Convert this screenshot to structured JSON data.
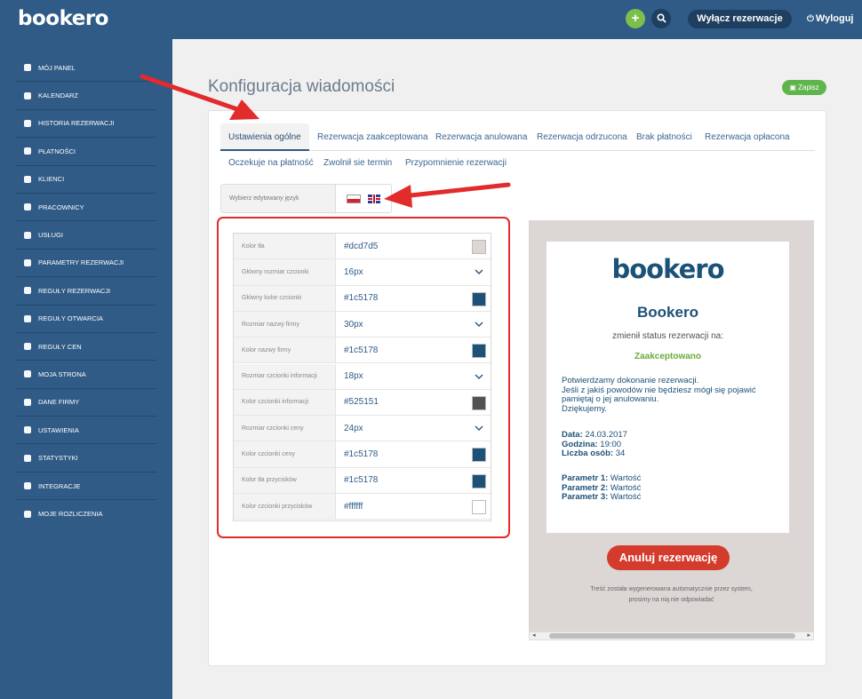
{
  "header": {
    "logo": "bookero",
    "add_label": "+",
    "toggle_label": "Wyłącz rezerwacje",
    "logout_label": "Wyloguj",
    "power_glyph": "⏻"
  },
  "sidebar": {
    "items": [
      {
        "label": "MÓJ PANEL",
        "icon": "dashboard-icon"
      },
      {
        "label": "KALENDARZ",
        "icon": "calendar-icon"
      },
      {
        "label": "HISTORIA REZERWACJI",
        "icon": "history-icon"
      },
      {
        "label": "PŁATNOŚCI",
        "icon": "credit-card-icon"
      },
      {
        "label": "KLIENCI",
        "icon": "users-icon"
      },
      {
        "label": "PRACOWNICY",
        "icon": "user-add-icon"
      },
      {
        "label": "USŁUGI",
        "icon": "cubes-icon"
      },
      {
        "label": "PARAMETRY REZERWACJI",
        "icon": "wrench-icon"
      },
      {
        "label": "REGUŁY REZERWACJI",
        "icon": "info-icon"
      },
      {
        "label": "REGUŁY OTWARCIA",
        "icon": "calendar-grid-icon"
      },
      {
        "label": "REGUŁY CEN",
        "icon": "dollar-icon"
      },
      {
        "label": "MOJA STRONA",
        "icon": "page-icon"
      },
      {
        "label": "DANE FIRMY",
        "icon": "building-icon"
      },
      {
        "label": "USTAWIENIA",
        "icon": "gear-icon"
      },
      {
        "label": "STATYSTYKI",
        "icon": "chart-icon"
      },
      {
        "label": "INTEGRACJE",
        "icon": "external-link-icon"
      },
      {
        "label": "MOJE ROZLICZENIA",
        "icon": "bank-icon"
      }
    ]
  },
  "page": {
    "title": "Konfiguracja wiadomości",
    "save_label": "Zapisz"
  },
  "tabs_row1": [
    "Ustawienia ogólne",
    "Rezerwacja zaakceptowana",
    "Rezerwacja anulowana",
    "Rezerwacja odrzucona",
    "Brak płatności",
    "Rezerwacja opłacona"
  ],
  "tabs_row2": [
    "Oczekuje na płatność",
    "Zwolnił sie termin",
    "Przypomnienie rezerwacji"
  ],
  "language": {
    "label": "Wybierz edytowany język"
  },
  "settings": [
    {
      "label": "Kolor tła",
      "value": "#dcd7d5",
      "kind": "color",
      "color": "#dcd7d5"
    },
    {
      "label": "Główny rozmiar czcionki",
      "value": "16px",
      "kind": "select"
    },
    {
      "label": "Główny kolor czcionki",
      "value": "#1c5178",
      "kind": "color",
      "color": "#1c5178"
    },
    {
      "label": "Rozmiar nazwy firmy",
      "value": "30px",
      "kind": "select"
    },
    {
      "label": "Kolor nazwy firmy",
      "value": "#1c5178",
      "kind": "color",
      "color": "#1c5178"
    },
    {
      "label": "Rozmiar czcionki informacji",
      "value": "18px",
      "kind": "select"
    },
    {
      "label": "Kolor czcionki informacji",
      "value": "#525151",
      "kind": "color",
      "color": "#525151"
    },
    {
      "label": "Rozmiar czcionki ceny",
      "value": "24px",
      "kind": "select"
    },
    {
      "label": "Kolor czcionki ceny",
      "value": "#1c5178",
      "kind": "color",
      "color": "#1c5178"
    },
    {
      "label": "Kolor tła przycisków",
      "value": "#1c5178",
      "kind": "color",
      "color": "#1c5178"
    },
    {
      "label": "Kolor czcionki przycisków",
      "value": "#ffffff",
      "kind": "color",
      "color": "#ffffff"
    }
  ],
  "preview": {
    "logo": "bookero",
    "company": "Bookero",
    "status_text": "zmienił status rezerwacji na:",
    "status": "Zaakceptowano",
    "info": [
      "Potwierdzamy dokonanie rezerwacji.",
      "Jeśli z jakiś powodów nie będziesz mógł się pojawić pamiętaj o jej anulowaniu.",
      "Dziękujemy."
    ],
    "details": [
      {
        "label": "Data:",
        "value": "24.03.2017"
      },
      {
        "label": "Godzina:",
        "value": "19:00"
      },
      {
        "label": "Liczba osób:",
        "value": "34"
      }
    ],
    "params": [
      {
        "label": "Parametr 1:",
        "value": "Wartość"
      },
      {
        "label": "Parametr 2:",
        "value": "Wartość"
      },
      {
        "label": "Parametr 3:",
        "value": "Wartość"
      }
    ],
    "button": "Anuluj rezerwację",
    "footer1": "Treść została wygenerowana automatycznie przez system,",
    "footer2": "prosimy na nią nie odpowiadać"
  },
  "colors": {
    "sidebar": "#2f5b86",
    "accent_green": "#5fb54b",
    "annotation_red": "#e22b2b",
    "cancel_button": "#d43b2c"
  }
}
